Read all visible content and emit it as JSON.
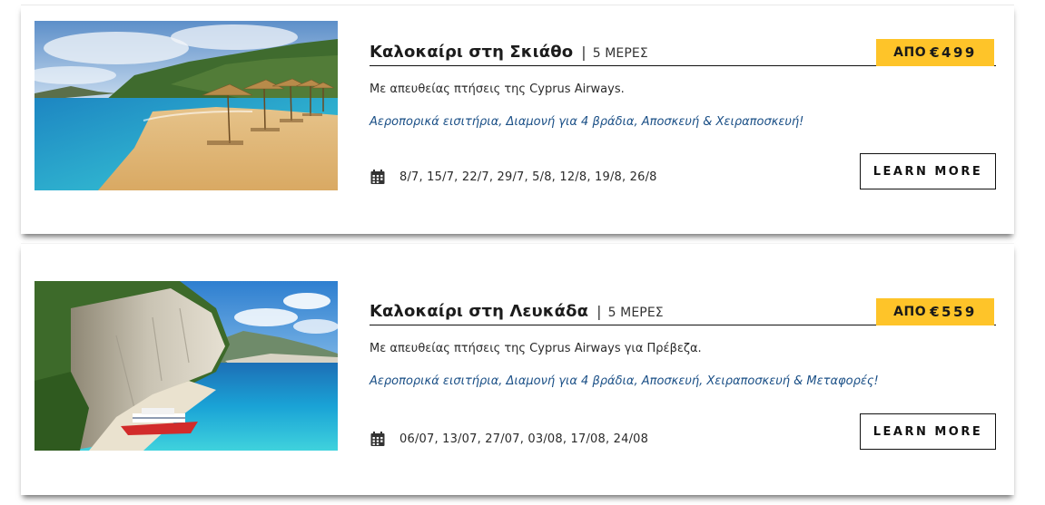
{
  "offers": [
    {
      "title": "Καλοκαίρι στη Σκιάθο",
      "separator": "|",
      "duration": "5 ΜΕΡΕΣ",
      "price_prefix": "ΑΠΟ",
      "price": "€499",
      "description": "Με απευθείας πτήσεις της Cyprus Airways.",
      "extras": "Αεροπορικά εισιτήρια, Διαμονή για 4 βράδια, Αποσκευή & Χειραποσκευή!",
      "calendar_icon": "calendar-icon",
      "dates": "8/7, 15/7, 22/7, 29/7, 5/8, 12/8, 19/8, 26/8",
      "button_label": "LEARN MORE"
    },
    {
      "title": "Καλοκαίρι στη Λευκάδα",
      "separator": "|",
      "duration": "5 ΜΕΡΕΣ",
      "price_prefix": "ΑΠΟ",
      "price": "€559",
      "description": "Με απευθείας πτήσεις της Cyprus Airways για Πρέβεζα.",
      "extras": "Αεροπορικά εισιτήρια, Διαμονή για 4 βράδια, Αποσκευή, Χειραποσκευή & Μεταφορές!",
      "calendar_icon": "calendar-icon",
      "dates": "06/07, 13/07, 27/07, 03/08, 17/08, 24/08",
      "button_label": "LEARN MORE"
    }
  ],
  "colors": {
    "price_badge": "#fec429",
    "extras_text": "#1a4f86",
    "button_border": "#111111"
  }
}
